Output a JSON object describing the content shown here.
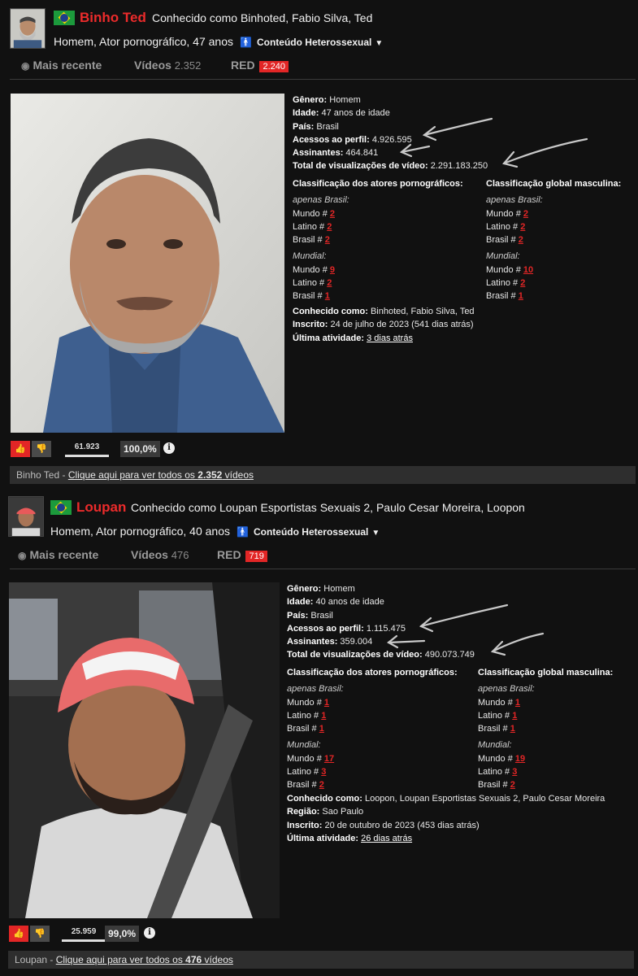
{
  "profiles": [
    {
      "name": "Binho Ted",
      "aka_header": "Conhecido como Binhoted, Fabio Silva, Ted",
      "subline": "Homem, Ator pornográfico, 47 anos",
      "content_type": "Conteúdo Heterossexual",
      "tabs": {
        "recent": "Mais recente",
        "videos": "Vídeos",
        "videos_count": "2.352",
        "red": "RED",
        "red_count": "2.240"
      },
      "info": {
        "genero_label": "Gênero:",
        "genero": "Homem",
        "idade_label": "Idade:",
        "idade": "47 anos de idade",
        "pais_label": "País:",
        "pais": "Brasil",
        "acessos_label": "Acessos ao perfil:",
        "acessos": "4.926.595",
        "assinantes_label": "Assinantes:",
        "assinantes": "464.841",
        "total_label": "Total de visualizações de vídeo:",
        "total": "2.291.183.250",
        "rank_actors_title": "Classificação dos atores pornográficos:",
        "rank_global_title": "Classificação global masculina:",
        "apenas_brasil": "apenas Brasil:",
        "mundial": "Mundial:",
        "mundo_label": "Mundo #",
        "latino_label": "Latino #",
        "brasil_label": "Brasil #",
        "actors_br": {
          "mundo": "2",
          "latino": "2",
          "brasil": "2"
        },
        "actors_world": {
          "mundo": "9",
          "latino": "2",
          "brasil": "1"
        },
        "global_br": {
          "mundo": "2",
          "latino": "2",
          "brasil": "2"
        },
        "global_world": {
          "mundo": "10",
          "latino": "2",
          "brasil": "1"
        },
        "conhecido_label": "Conhecido como:",
        "conhecido": "Binhoted, Fabio Silva, Ted",
        "inscrito_label": "Inscrito:",
        "inscrito": "24 de julho de 2023 (541 dias atrás)",
        "ultima_label": "Última atividade:",
        "ultima": "3 dias atrás"
      },
      "rating": {
        "votes": "61.923",
        "votes_fraction": 1.0,
        "percent": "100,0%"
      },
      "footer": {
        "prefix": "Binho Ted - ",
        "link_a": "Clique aqui para ver todos os ",
        "link_count": "2.352",
        "link_b": " vídeos"
      }
    },
    {
      "name": "Loupan",
      "aka_header": "Conhecido como Loupan Esportistas Sexuais 2, Paulo Cesar Moreira, Loopon",
      "subline": "Homem, Ator pornográfico, 40 anos",
      "content_type": "Conteúdo Heterossexual",
      "tabs": {
        "recent": "Mais recente",
        "videos": "Vídeos",
        "videos_count": "476",
        "red": "RED",
        "red_count": "719"
      },
      "info": {
        "genero_label": "Gênero:",
        "genero": "Homem",
        "idade_label": "Idade:",
        "idade": "40 anos de idade",
        "pais_label": "País:",
        "pais": "Brasil",
        "acessos_label": "Acessos ao perfil:",
        "acessos": "1.115.475",
        "assinantes_label": "Assinantes:",
        "assinantes": "359.004",
        "total_label": "Total de visualizações de vídeo:",
        "total": "490.073.749",
        "rank_actors_title": "Classificação dos atores pornográficos:",
        "rank_global_title": "Classificação global masculina:",
        "apenas_brasil": "apenas Brasil:",
        "mundial": "Mundial:",
        "mundo_label": "Mundo #",
        "latino_label": "Latino #",
        "brasil_label": "Brasil #",
        "actors_br": {
          "mundo": "1",
          "latino": "1",
          "brasil": "1"
        },
        "actors_world": {
          "mundo": "17",
          "latino": "3",
          "brasil": "2"
        },
        "global_br": {
          "mundo": "1",
          "latino": "1",
          "brasil": "1"
        },
        "global_world": {
          "mundo": "19",
          "latino": "3",
          "brasil": "2"
        },
        "conhecido_label": "Conhecido como:",
        "conhecido": "Loopon, Loupan Esportistas Sexuais 2, Paulo Cesar Moreira",
        "regiao_label": "Região:",
        "regiao": "Sao Paulo",
        "inscrito_label": "Inscrito:",
        "inscrito": "20 de outubro de 2023 (453 dias atrás)",
        "ultima_label": "Última atividade:",
        "ultima": "26 dias atrás"
      },
      "rating": {
        "votes": "25.959",
        "votes_fraction": 0.99,
        "percent": "99,0%"
      },
      "footer": {
        "prefix": "Loupan - ",
        "link_a": "Clique aqui para ver todos os ",
        "link_count": "476",
        "link_b": " vídeos"
      }
    }
  ],
  "colors": {
    "accent_red": "#e22626",
    "background": "#111111"
  },
  "icons": [
    "brazil-flag-icon",
    "person-icon",
    "caret-down-icon",
    "rss-icon",
    "thumbs-up-icon",
    "thumbs-down-icon",
    "info-icon",
    "annotation-arrow"
  ]
}
